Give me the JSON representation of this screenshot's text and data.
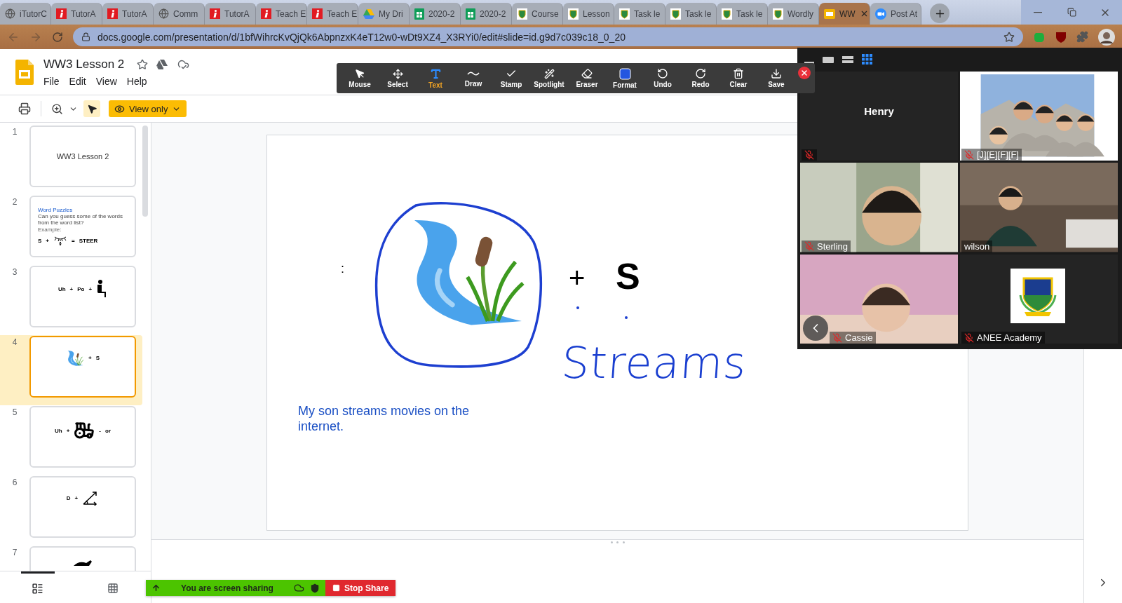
{
  "browser": {
    "tabs": [
      {
        "kind": "globe",
        "title": "iTutorC",
        "selected": false
      },
      {
        "kind": "tutor",
        "title": "TutorA",
        "selected": false
      },
      {
        "kind": "tutor",
        "title": "TutorA",
        "selected": false
      },
      {
        "kind": "globe",
        "title": "Comm",
        "selected": false
      },
      {
        "kind": "tutor",
        "title": "TutorA",
        "selected": false
      },
      {
        "kind": "tutor",
        "title": "Teach E",
        "selected": false
      },
      {
        "kind": "tutor",
        "title": "Teach E",
        "selected": false
      },
      {
        "kind": "drive",
        "title": "My Dri",
        "selected": false
      },
      {
        "kind": "sheets",
        "title": "2020-2",
        "selected": false
      },
      {
        "kind": "sheets",
        "title": "2020-2",
        "selected": false
      },
      {
        "kind": "school",
        "title": "Course",
        "selected": false
      },
      {
        "kind": "school",
        "title": "Lesson",
        "selected": false
      },
      {
        "kind": "school",
        "title": "Task le",
        "selected": false
      },
      {
        "kind": "school",
        "title": "Task le",
        "selected": false
      },
      {
        "kind": "school",
        "title": "Task le",
        "selected": false
      },
      {
        "kind": "school",
        "title": "Wordly",
        "selected": false
      },
      {
        "kind": "slides",
        "title": "WW",
        "selected": true
      },
      {
        "kind": "zoom",
        "title": "Post At",
        "selected": false
      }
    ],
    "url": "docs.google.com/presentation/d/1bfWihrcKvQjQk6AbpnzxK4eT12w0-wDt9XZ4_X3RYi0/edit#slide=id.g9d7c039c18_0_20"
  },
  "document": {
    "title": "WW3 Lesson 2",
    "menu": [
      "File",
      "Edit",
      "View",
      "Help"
    ],
    "pointer_selected": true,
    "mode_button": "View only"
  },
  "slides": [
    {
      "number": "1",
      "selected": false,
      "kind": "title",
      "title": "WW3 Lesson 2"
    },
    {
      "number": "2",
      "selected": false,
      "kind": "intro",
      "heading": "Word Puzzles",
      "prompt": "Can you guess some of the words from the word list?",
      "example": "Example:",
      "parts": [
        {
          "kind": "text",
          "text": "S"
        },
        {
          "kind": "text",
          "text": "+"
        },
        {
          "kind": "icon"
        },
        {
          "kind": "text",
          "text": "="
        },
        {
          "kind": "text",
          "text": "STEER"
        }
      ]
    },
    {
      "number": "3",
      "selected": false,
      "kind": "equation",
      "parts": [
        {
          "kind": "text",
          "text": "Uh"
        },
        {
          "kind": "text",
          "text": "+"
        },
        {
          "kind": "text",
          "text": "Po"
        },
        {
          "kind": "text",
          "text": "+"
        },
        {
          "kind": "icon"
        }
      ]
    },
    {
      "number": "4",
      "selected": true,
      "kind": "equation",
      "parts": [
        {
          "kind": "icon"
        },
        {
          "kind": "text",
          "text": "+"
        },
        {
          "kind": "text",
          "text": "S"
        }
      ]
    },
    {
      "number": "5",
      "selected": false,
      "kind": "equation",
      "parts": [
        {
          "kind": "text",
          "text": "Uh"
        },
        {
          "kind": "text",
          "text": "+"
        },
        {
          "kind": "icon"
        },
        {
          "kind": "text",
          "text": "-"
        },
        {
          "kind": "text",
          "text": "or"
        }
      ]
    },
    {
      "number": "6",
      "selected": false,
      "kind": "equation",
      "parts": [
        {
          "kind": "text",
          "text": "D"
        },
        {
          "kind": "text",
          "text": "+"
        },
        {
          "kind": "icon"
        }
      ]
    },
    {
      "number": "7",
      "selected": false,
      "kind": "equation",
      "parts": [
        {
          "kind": "icon"
        }
      ]
    }
  ],
  "current_slide": {
    "colon": ":",
    "plus": "+",
    "letter": "S",
    "handwriting": "Streams",
    "sentence": "My son streams movies on the internet."
  },
  "filmstrip_views": [
    {
      "selected": true
    },
    {
      "selected": false
    }
  ],
  "annotation_tools": [
    {
      "label": "Mouse",
      "selected": false
    },
    {
      "label": "Select",
      "selected": false
    },
    {
      "label": "Text",
      "selected": true
    },
    {
      "label": "Draw",
      "selected": false
    },
    {
      "label": "Stamp",
      "selected": false
    },
    {
      "label": "Spotlight",
      "selected": false
    },
    {
      "label": "Eraser",
      "selected": false
    },
    {
      "label": "Format",
      "selected": false
    },
    {
      "label": "Undo",
      "selected": false
    },
    {
      "label": "Redo",
      "selected": false
    },
    {
      "label": "Clear",
      "selected": false
    },
    {
      "label": "Save",
      "selected": false
    }
  ],
  "meeting": {
    "view_modes": [
      {
        "selected": false
      },
      {
        "selected": false
      },
      {
        "selected": false
      },
      {
        "selected": true
      }
    ],
    "tiles": [
      {
        "kind": "name",
        "name": "Henry",
        "muted": true
      },
      {
        "kind": "video",
        "name": "[J][E][F][F]",
        "muted": true
      },
      {
        "kind": "video",
        "name": "Sterling",
        "muted": true
      },
      {
        "kind": "video",
        "name": "wilson",
        "muted": false
      },
      {
        "kind": "video",
        "name": "Cassie",
        "muted": true
      },
      {
        "kind": "logo",
        "name": "ANEE Academy",
        "muted": true
      }
    ]
  },
  "share_bar": {
    "status": "You are screen sharing",
    "stop_label": "Stop Share"
  }
}
